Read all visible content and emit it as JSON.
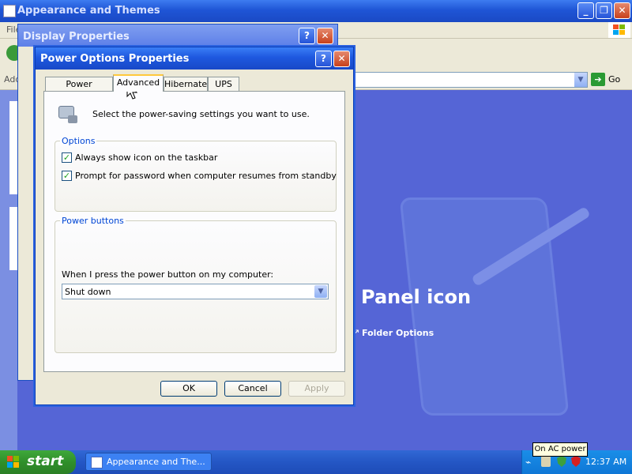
{
  "background_window": {
    "title": "Appearance and Themes",
    "menu_first": "File",
    "address_label": "Address",
    "go_label": "Go",
    "panel_heading": "Panel icon",
    "panel_link": "Folder Options"
  },
  "display_properties": {
    "title": "Display Properties"
  },
  "power_dialog": {
    "title": "Power Options Properties",
    "tabs": [
      {
        "label": "Power Schemes",
        "active": false
      },
      {
        "label": "Advanced",
        "active": true
      },
      {
        "label": "Hibernate",
        "active": false
      },
      {
        "label": "UPS",
        "active": false
      }
    ],
    "intro_text": "Select the power-saving settings you want to use.",
    "options_group": {
      "label": "Options",
      "checkboxes": [
        {
          "label": "Always show icon on the taskbar",
          "checked": true
        },
        {
          "label": "Prompt for password when computer resumes from standby",
          "checked": true
        }
      ]
    },
    "power_buttons_group": {
      "label": "Power buttons",
      "dropdown_label": "When I press the power button on my computer:",
      "dropdown_value": "Shut down"
    },
    "buttons": {
      "ok": "OK",
      "cancel": "Cancel",
      "apply": "Apply"
    }
  },
  "taskbar": {
    "start_label": "start",
    "task_item": "Appearance and The...",
    "clock": "12:37 AM",
    "tooltip": "On AC power"
  },
  "colors": {
    "title_bar": "#1f55d6",
    "dialog_face": "#ece9d8",
    "taskbar": "#2456c4",
    "start_button": "#2f8f2a",
    "desktop": "#5a6fd8"
  }
}
